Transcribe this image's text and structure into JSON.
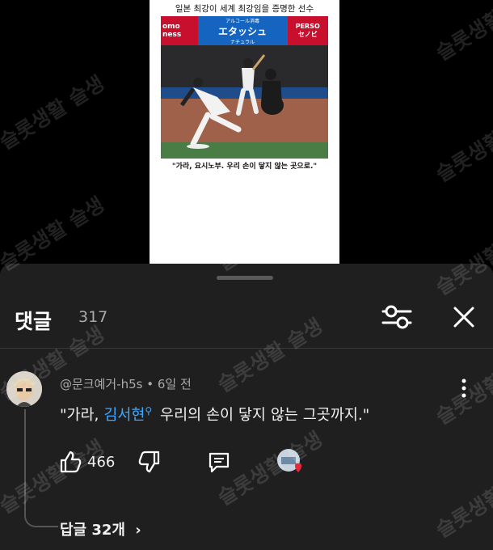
{
  "video": {
    "caption_top": "일본 최강이 세계 최강임을 증명한 선수",
    "ad_left": "omo\nness",
    "ad_center_small": "アルコール消毒",
    "ad_center_main": "エタッシュ",
    "ad_center_sub": "ナチュラル",
    "ad_right_top": "PERSO",
    "ad_right_main": "セノビ",
    "caption_bottom": "\"가라, 요시노부. 우리 손이 닿지 않는 곳으로.\""
  },
  "comments": {
    "title": "댓글",
    "count": "317",
    "filter_icon": "sliders-icon",
    "close_icon": "close-icon",
    "item": {
      "author": "@문크예거-h5s",
      "time": "6일 전",
      "text_before": "\"가라, ",
      "mention": "김서현",
      "text_after": " 우리의 손이 닿지 않는 그곳까지.\"",
      "likes": "466",
      "reply_label": "답글 32개"
    }
  },
  "watermark": "슬롯생활 슬생",
  "colors": {
    "sheet_bg": "#1f1f1f",
    "mention": "#3ea6ff",
    "heart": "#e8283a"
  }
}
